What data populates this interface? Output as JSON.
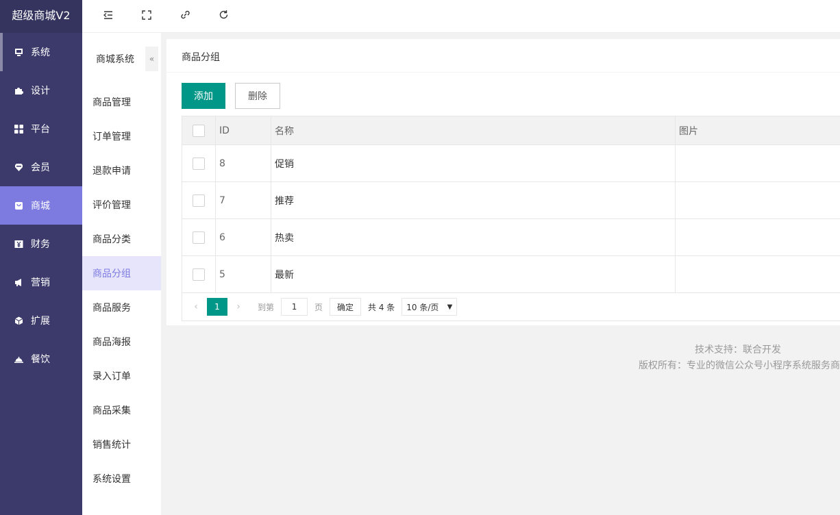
{
  "app": {
    "title": "超级商城V2"
  },
  "nav": [
    {
      "label": "系统",
      "icon": "monitor-icon"
    },
    {
      "label": "设计",
      "icon": "puzzle-icon"
    },
    {
      "label": "平台",
      "icon": "grid-icon"
    },
    {
      "label": "会员",
      "icon": "heart-icon"
    },
    {
      "label": "商城",
      "icon": "shop-bag-icon"
    },
    {
      "label": "财务",
      "icon": "yen-icon"
    },
    {
      "label": "营销",
      "icon": "megaphone-icon"
    },
    {
      "label": "扩展",
      "icon": "cube-icon"
    },
    {
      "label": "餐饮",
      "icon": "cloche-icon"
    }
  ],
  "submenu": {
    "title": "商城系统",
    "collapse_glyph": "«",
    "items": [
      "商品管理",
      "订单管理",
      "退款申请",
      "评价管理",
      "商品分类",
      "商品分组",
      "商品服务",
      "商品海报",
      "录入订单",
      "商品采集",
      "销售统计",
      "系统设置"
    ]
  },
  "card": {
    "title": "商品分组",
    "add_label": "添加",
    "delete_label": "删除"
  },
  "table": {
    "headers": {
      "id": "ID",
      "name": "名称",
      "image": "图片"
    },
    "rows": [
      {
        "id": "8",
        "name": "促销"
      },
      {
        "id": "7",
        "name": "推荐"
      },
      {
        "id": "6",
        "name": "热卖"
      },
      {
        "id": "5",
        "name": "最新"
      }
    ]
  },
  "pager": {
    "prev": "‹",
    "current": "1",
    "next": "›",
    "goto_label": "到第",
    "goto_value": "1",
    "page_unit": "页",
    "confirm": "确定",
    "total": "共 4 条",
    "page_size": "10 条/页",
    "select_arrow": "▼"
  },
  "footer": {
    "line1": "技术支持：联合开发",
    "line2": "版权所有：专业的微信公众号小程序系统服务商"
  },
  "colors": {
    "sidebar_bg": "#3b3a6b",
    "active_nav": "#7d7ae0",
    "primary": "#009688"
  }
}
